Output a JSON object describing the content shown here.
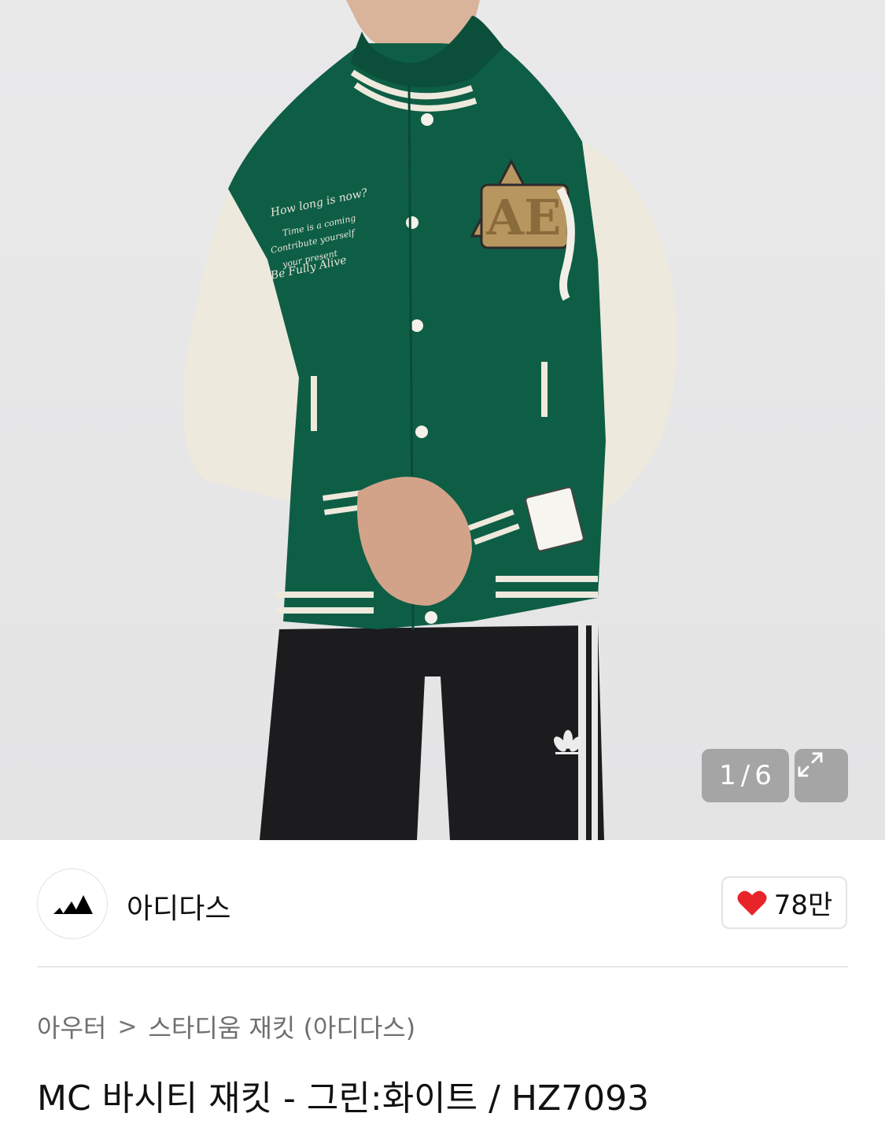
{
  "gallery": {
    "current": "1",
    "separator": "/",
    "total": "6",
    "image_alt": "Green and white varsity jacket worn by model with black adidas track pants"
  },
  "icons": {
    "expand": "expand-icon",
    "heart": "heart-icon",
    "brand_logo": "adidas-logo"
  },
  "brand": {
    "name": "아디다스"
  },
  "like": {
    "count": "78만"
  },
  "breadcrumb": {
    "category": "아우터",
    "separator": ">",
    "subcategory": "스타디움 재킷 (아디다스)"
  },
  "product": {
    "title": "MC 바시티 재킷 - 그린:화이트 / HZ7093"
  },
  "colors": {
    "jacket_green": "#0e5e45",
    "sleeve_cream": "#eee9dd",
    "heart_red": "#e8242b",
    "patch_tan": "#b8965f"
  }
}
